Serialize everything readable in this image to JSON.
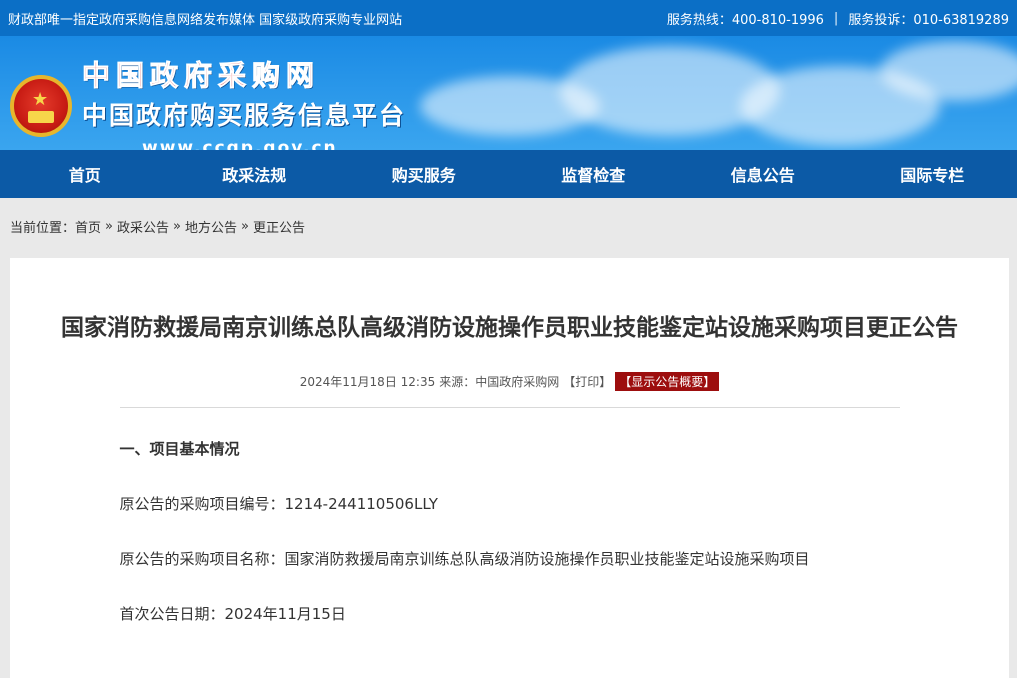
{
  "topbar": {
    "left": "财政部唯一指定政府采购信息网络发布媒体 国家级政府采购专业网站",
    "hotline": "服务热线：400-810-1996",
    "divider": "|",
    "complaint": "服务投诉：010-63819289"
  },
  "logo": {
    "line1": "中国政府采购网",
    "line2": "中国政府购买服务信息平台",
    "line3": "www.ccgp.gov.cn"
  },
  "nav": [
    "首页",
    "政采法规",
    "购买服务",
    "监督检查",
    "信息公告",
    "国际专栏"
  ],
  "breadcrumb": {
    "prefix": "当前位置：",
    "items": [
      "首页",
      "政采公告",
      "地方公告",
      "更正公告"
    ],
    "sep": "»"
  },
  "article": {
    "title": "国家消防救援局南京训练总队高级消防设施操作员职业技能鉴定站设施采购项目更正公告",
    "datetime": "2024年11月18日 12:35",
    "source": "来源：中国政府采购网",
    "print": "【打印】",
    "summary": "【显示公告概要】",
    "section1": "一、项目基本情况",
    "lines": [
      "原公告的采购项目编号：1214-244110506LLY",
      "原公告的采购项目名称：国家消防救援局南京训练总队高级消防设施操作员职业技能鉴定站设施采购项目",
      "首次公告日期：2024年11月15日"
    ]
  }
}
